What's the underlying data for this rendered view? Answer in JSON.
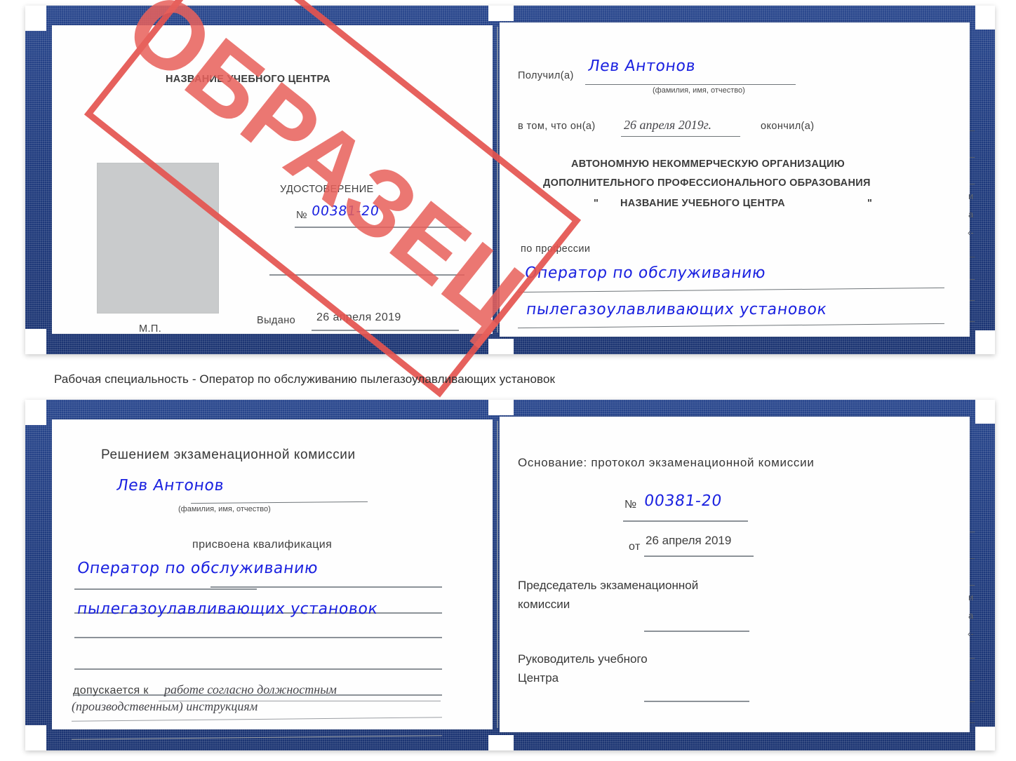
{
  "watermark": {
    "text": "ОБРАЗЕЦ",
    "color": "#e4544f"
  },
  "caption": {
    "text": "Рабочая специальность - Оператор по обслуживанию пылегазоулавливающих установок"
  },
  "colors": {
    "cover_blue": "#1e3a7d",
    "handwriting_blue": "#1b22e0",
    "photo_gray": "#c9cbcc",
    "stamp_red": "#e4544f"
  },
  "certificate_front": {
    "left_page": {
      "center_title": "НАЗВАНИЕ УЧЕБНОГО ЦЕНТРА",
      "doc_type": "УДОСТОВЕРЕНИЕ",
      "number_label": "№",
      "number_value": "00381-20",
      "issued_label": "Выдано",
      "issued_value": "26 апреля 2019",
      "seal_label": "М.П.",
      "photo_placeholder": "photo-placeholder"
    },
    "right_page": {
      "received_label": "Получил(а)",
      "received_value": "Лев Антонов",
      "received_hint": "(фамилия, имя, отчество)",
      "that_he_label": "в том, что он(а)",
      "that_he_value": "26 апреля 2019г.",
      "finished_label": "окончил(а)",
      "org_line1": "АВТОНОМНУЮ НЕКОММЕРЧЕСКУЮ ОРГАНИЗАЦИЮ",
      "org_line2": "ДОПОЛНИТЕЛЬНОГО ПРОФЕССИОНАЛЬНОГО ОБРАЗОВАНИЯ",
      "org_quote_open": "\"",
      "org_line3": "НАЗВАНИЕ УЧЕБНОГО ЦЕНТРА",
      "org_quote_close": "\"",
      "profession_label": "по профессии",
      "profession_line1": "Оператор по обслуживанию",
      "profession_line2": "пылегазоулавливающих установок",
      "edge_fragments": [
        "–",
        "–",
        "–",
        "и",
        "а",
        "‹-",
        "–",
        "–",
        "–",
        "–"
      ]
    }
  },
  "certificate_back": {
    "left_page": {
      "title": "Решением экзаменационной комиссии",
      "name_value": "Лев Антонов",
      "name_hint": "(фамилия, имя, отчество)",
      "qualification_label": "присвоена квалификация",
      "qualification_line1": "Оператор по обслуживанию",
      "qualification_line2": "пылегазоулавливающих установок",
      "allowed_label": "допускается к",
      "allowed_line1": "работе согласно должностным",
      "allowed_line2": "(производственным) инструкциям"
    },
    "right_page": {
      "basis_label": "Основание: протокол экзаменационной комиссии",
      "number_label": "№",
      "number_value": "00381-20",
      "date_label": "от",
      "date_value": "26 апреля 2019",
      "chairman_line1": "Председатель экзаменационной",
      "chairman_line2": "комиссии",
      "head_line1": "Руководитель учебного",
      "head_line2": "Центра",
      "edge_fragments": [
        "–",
        "–",
        "–",
        "и",
        "а",
        "‹-",
        "–",
        "–",
        "–",
        "–"
      ]
    }
  }
}
